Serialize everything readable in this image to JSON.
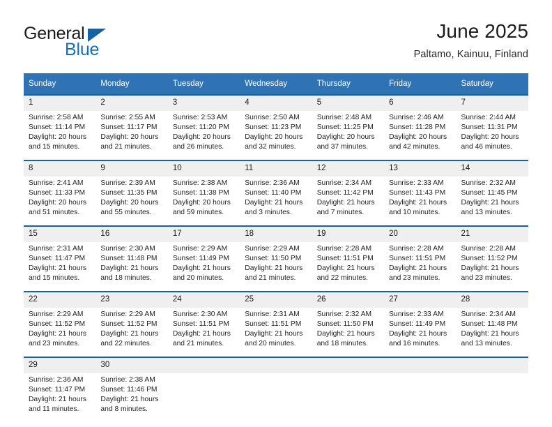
{
  "logo": {
    "word_top": "General",
    "word_bottom": "Blue",
    "triangle": "blue-triangle-icon",
    "color_dark": "#1b1b1b",
    "color_blue": "#1570bb"
  },
  "header": {
    "title": "June 2025",
    "subtitle": "Paltamo, Kainuu, Finland"
  },
  "theme": {
    "header_bg": "#3073b5",
    "row_divider": "#1a5fa0",
    "daynum_bg": "#efefef"
  },
  "weekday_headers": [
    "Sunday",
    "Monday",
    "Tuesday",
    "Wednesday",
    "Thursday",
    "Friday",
    "Saturday"
  ],
  "weeks": [
    {
      "days": [
        {
          "num": "1",
          "sunrise": "Sunrise: 2:58 AM",
          "sunset": "Sunset: 11:14 PM",
          "daylight1": "Daylight: 20 hours",
          "daylight2": "and 15 minutes."
        },
        {
          "num": "2",
          "sunrise": "Sunrise: 2:55 AM",
          "sunset": "Sunset: 11:17 PM",
          "daylight1": "Daylight: 20 hours",
          "daylight2": "and 21 minutes."
        },
        {
          "num": "3",
          "sunrise": "Sunrise: 2:53 AM",
          "sunset": "Sunset: 11:20 PM",
          "daylight1": "Daylight: 20 hours",
          "daylight2": "and 26 minutes."
        },
        {
          "num": "4",
          "sunrise": "Sunrise: 2:50 AM",
          "sunset": "Sunset: 11:23 PM",
          "daylight1": "Daylight: 20 hours",
          "daylight2": "and 32 minutes."
        },
        {
          "num": "5",
          "sunrise": "Sunrise: 2:48 AM",
          "sunset": "Sunset: 11:25 PM",
          "daylight1": "Daylight: 20 hours",
          "daylight2": "and 37 minutes."
        },
        {
          "num": "6",
          "sunrise": "Sunrise: 2:46 AM",
          "sunset": "Sunset: 11:28 PM",
          "daylight1": "Daylight: 20 hours",
          "daylight2": "and 42 minutes."
        },
        {
          "num": "7",
          "sunrise": "Sunrise: 2:44 AM",
          "sunset": "Sunset: 11:31 PM",
          "daylight1": "Daylight: 20 hours",
          "daylight2": "and 46 minutes."
        }
      ]
    },
    {
      "days": [
        {
          "num": "8",
          "sunrise": "Sunrise: 2:41 AM",
          "sunset": "Sunset: 11:33 PM",
          "daylight1": "Daylight: 20 hours",
          "daylight2": "and 51 minutes."
        },
        {
          "num": "9",
          "sunrise": "Sunrise: 2:39 AM",
          "sunset": "Sunset: 11:35 PM",
          "daylight1": "Daylight: 20 hours",
          "daylight2": "and 55 minutes."
        },
        {
          "num": "10",
          "sunrise": "Sunrise: 2:38 AM",
          "sunset": "Sunset: 11:38 PM",
          "daylight1": "Daylight: 20 hours",
          "daylight2": "and 59 minutes."
        },
        {
          "num": "11",
          "sunrise": "Sunrise: 2:36 AM",
          "sunset": "Sunset: 11:40 PM",
          "daylight1": "Daylight: 21 hours",
          "daylight2": "and 3 minutes."
        },
        {
          "num": "12",
          "sunrise": "Sunrise: 2:34 AM",
          "sunset": "Sunset: 11:42 PM",
          "daylight1": "Daylight: 21 hours",
          "daylight2": "and 7 minutes."
        },
        {
          "num": "13",
          "sunrise": "Sunrise: 2:33 AM",
          "sunset": "Sunset: 11:43 PM",
          "daylight1": "Daylight: 21 hours",
          "daylight2": "and 10 minutes."
        },
        {
          "num": "14",
          "sunrise": "Sunrise: 2:32 AM",
          "sunset": "Sunset: 11:45 PM",
          "daylight1": "Daylight: 21 hours",
          "daylight2": "and 13 minutes."
        }
      ]
    },
    {
      "days": [
        {
          "num": "15",
          "sunrise": "Sunrise: 2:31 AM",
          "sunset": "Sunset: 11:47 PM",
          "daylight1": "Daylight: 21 hours",
          "daylight2": "and 15 minutes."
        },
        {
          "num": "16",
          "sunrise": "Sunrise: 2:30 AM",
          "sunset": "Sunset: 11:48 PM",
          "daylight1": "Daylight: 21 hours",
          "daylight2": "and 18 minutes."
        },
        {
          "num": "17",
          "sunrise": "Sunrise: 2:29 AM",
          "sunset": "Sunset: 11:49 PM",
          "daylight1": "Daylight: 21 hours",
          "daylight2": "and 20 minutes."
        },
        {
          "num": "18",
          "sunrise": "Sunrise: 2:29 AM",
          "sunset": "Sunset: 11:50 PM",
          "daylight1": "Daylight: 21 hours",
          "daylight2": "and 21 minutes."
        },
        {
          "num": "19",
          "sunrise": "Sunrise: 2:28 AM",
          "sunset": "Sunset: 11:51 PM",
          "daylight1": "Daylight: 21 hours",
          "daylight2": "and 22 minutes."
        },
        {
          "num": "20",
          "sunrise": "Sunrise: 2:28 AM",
          "sunset": "Sunset: 11:51 PM",
          "daylight1": "Daylight: 21 hours",
          "daylight2": "and 23 minutes."
        },
        {
          "num": "21",
          "sunrise": "Sunrise: 2:28 AM",
          "sunset": "Sunset: 11:52 PM",
          "daylight1": "Daylight: 21 hours",
          "daylight2": "and 23 minutes."
        }
      ]
    },
    {
      "days": [
        {
          "num": "22",
          "sunrise": "Sunrise: 2:29 AM",
          "sunset": "Sunset: 11:52 PM",
          "daylight1": "Daylight: 21 hours",
          "daylight2": "and 23 minutes."
        },
        {
          "num": "23",
          "sunrise": "Sunrise: 2:29 AM",
          "sunset": "Sunset: 11:52 PM",
          "daylight1": "Daylight: 21 hours",
          "daylight2": "and 22 minutes."
        },
        {
          "num": "24",
          "sunrise": "Sunrise: 2:30 AM",
          "sunset": "Sunset: 11:51 PM",
          "daylight1": "Daylight: 21 hours",
          "daylight2": "and 21 minutes."
        },
        {
          "num": "25",
          "sunrise": "Sunrise: 2:31 AM",
          "sunset": "Sunset: 11:51 PM",
          "daylight1": "Daylight: 21 hours",
          "daylight2": "and 20 minutes."
        },
        {
          "num": "26",
          "sunrise": "Sunrise: 2:32 AM",
          "sunset": "Sunset: 11:50 PM",
          "daylight1": "Daylight: 21 hours",
          "daylight2": "and 18 minutes."
        },
        {
          "num": "27",
          "sunrise": "Sunrise: 2:33 AM",
          "sunset": "Sunset: 11:49 PM",
          "daylight1": "Daylight: 21 hours",
          "daylight2": "and 16 minutes."
        },
        {
          "num": "28",
          "sunrise": "Sunrise: 2:34 AM",
          "sunset": "Sunset: 11:48 PM",
          "daylight1": "Daylight: 21 hours",
          "daylight2": "and 13 minutes."
        }
      ]
    },
    {
      "days": [
        {
          "num": "29",
          "sunrise": "Sunrise: 2:36 AM",
          "sunset": "Sunset: 11:47 PM",
          "daylight1": "Daylight: 21 hours",
          "daylight2": "and 11 minutes."
        },
        {
          "num": "30",
          "sunrise": "Sunrise: 2:38 AM",
          "sunset": "Sunset: 11:46 PM",
          "daylight1": "Daylight: 21 hours",
          "daylight2": "and 8 minutes."
        },
        null,
        null,
        null,
        null,
        null
      ]
    }
  ]
}
